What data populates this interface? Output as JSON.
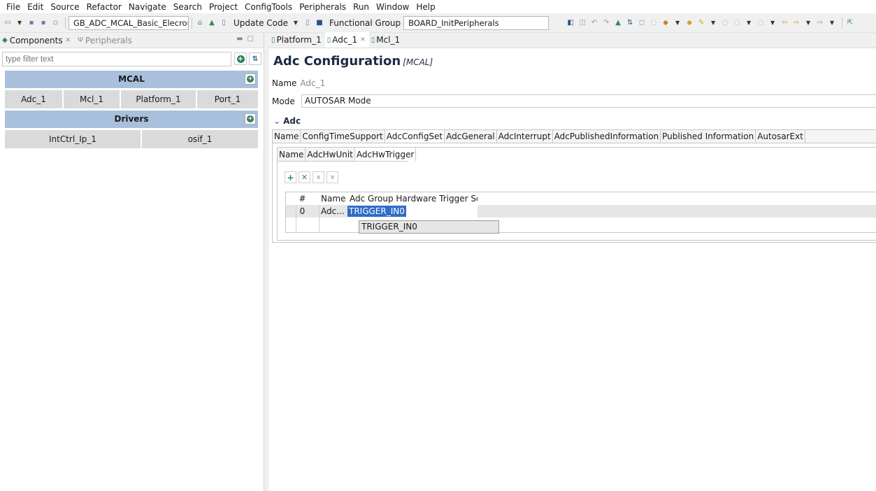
{
  "menu": [
    "File",
    "Edit",
    "Source",
    "Refactor",
    "Navigate",
    "Search",
    "Project",
    "ConfigTools",
    "Peripherals",
    "Run",
    "Window",
    "Help"
  ],
  "toolbar": {
    "project_combo": "GB_ADC_MCAL_Basic_ElecronicsV_S.",
    "update_code_label": "Update Code",
    "functional_group_label": "Functional Group",
    "functional_group_value": "BOARD_InitPeripherals"
  },
  "left_panel": {
    "tabs": [
      {
        "label": "Components",
        "active": true
      },
      {
        "label": "Peripherals",
        "active": false
      }
    ],
    "filter_placeholder": "type filter text",
    "groups": [
      {
        "title": "MCAL",
        "components": [
          "Adc_1",
          "Mcl_1",
          "Platform_1",
          "Port_1"
        ]
      },
      {
        "title": "Drivers",
        "components": [
          "IntCtrl_Ip_1",
          "osif_1"
        ]
      }
    ]
  },
  "editor": {
    "tabs": [
      {
        "label": "Platform_1",
        "active": false
      },
      {
        "label": "Adc_1",
        "active": true
      },
      {
        "label": "Mcl_1",
        "active": false
      }
    ],
    "title": "Adc Configuration",
    "title_sub": "[MCAL]",
    "name_label": "Name",
    "name_value": "Adc_1",
    "mode_label": "Mode",
    "mode_value": "AUTOSAR Mode",
    "section": "Adc",
    "outer_tabs": [
      "Name",
      "ConfigTimeSupport",
      "AdcConfigSet",
      "AdcGeneral",
      "AdcInterrupt",
      "AdcPublishedInformation",
      "Published Information",
      "AutosarExt"
    ],
    "outer_selected": "AdcConfigSet",
    "inner_tabs": [
      "Name",
      "AdcHwUnit",
      "AdcHwTrigger"
    ],
    "inner_selected": "AdcHwTrigger",
    "table": {
      "columns": [
        "#",
        "Name",
        "Adc Group Hardware Trigger Source"
      ],
      "rows": [
        {
          "index": "0",
          "name": "Adc...",
          "source": "TRIGGER_IN0"
        }
      ],
      "dropdown_option": "TRIGGER_IN0"
    }
  },
  "colors": {
    "group_header": "#a8c0dc",
    "component_cell": "#dadada",
    "selection": "#2f6cc8",
    "accent_green": "#2e7d5b"
  }
}
